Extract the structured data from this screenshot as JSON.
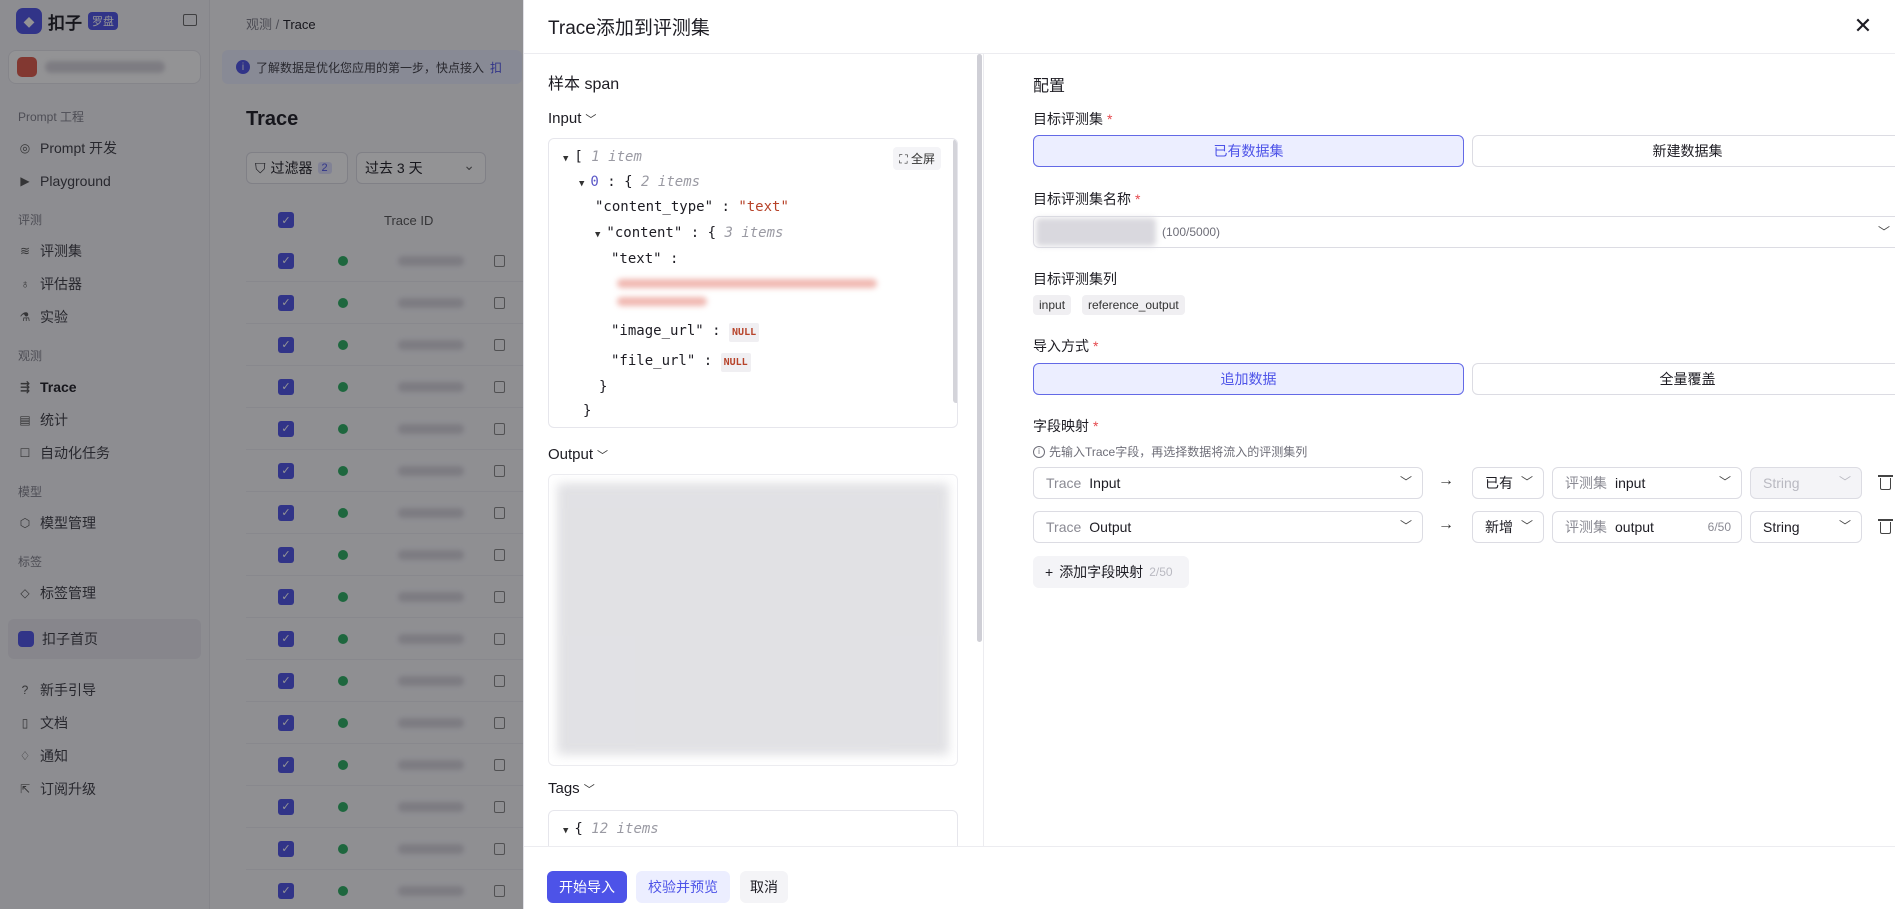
{
  "app": {
    "brand_name": "扣子",
    "brand_tag": "罗盘",
    "sidebar": {
      "groups": [
        {
          "label": "Prompt 工程",
          "items": [
            {
              "label": "Prompt 开发",
              "icon": "target-icon"
            },
            {
              "label": "Playground",
              "icon": "play-icon"
            }
          ]
        },
        {
          "label": "评测",
          "items": [
            {
              "label": "评测集",
              "icon": "database-icon"
            },
            {
              "label": "评估器",
              "icon": "bulb-icon"
            },
            {
              "label": "实验",
              "icon": "flask-icon"
            }
          ]
        },
        {
          "label": "观测",
          "items": [
            {
              "label": "Trace",
              "icon": "trace-icon"
            },
            {
              "label": "统计",
              "icon": "chart-icon"
            },
            {
              "label": "自动化任务",
              "icon": "task-icon"
            }
          ]
        },
        {
          "label": "模型",
          "items": [
            {
              "label": "模型管理",
              "icon": "cube-icon"
            }
          ]
        },
        {
          "label": "标签",
          "items": [
            {
              "label": "标签管理",
              "icon": "tag-icon"
            }
          ]
        }
      ],
      "home": "扣子首页",
      "bottom": [
        {
          "label": "新手引导",
          "icon": "help-icon"
        },
        {
          "label": "文档",
          "icon": "doc-icon"
        },
        {
          "label": "通知",
          "icon": "bell-icon"
        },
        {
          "label": "订阅升级",
          "icon": "upgrade-icon"
        }
      ]
    },
    "breadcrumb": {
      "parent": "观测",
      "current": "Trace"
    },
    "notice": "了解数据是优化您应用的第一步，快点接入",
    "notice_link": "扣",
    "page_title": "Trace",
    "filter_label": "过滤器",
    "filter_count": "2",
    "time_range": "过去 3 天",
    "table_header_trace": "Trace ID",
    "checkmark": "✓"
  },
  "modal": {
    "title": "Trace添加到评测集",
    "close": "✕",
    "sample": {
      "title": "样本 span",
      "input_label": "Input",
      "output_label": "Output",
      "tags_label": "Tags",
      "fullscreen": "全屏",
      "json": {
        "open_bracket": "[",
        "item_count": "1 item",
        "index": "0",
        "colon": ":",
        "open_brace": "{",
        "index_count": "2 items",
        "content_type_key": "\"content_type\"",
        "content_type_val": "\"text\"",
        "content_key": "\"content\"",
        "content_count": "3 items",
        "text_key": "\"text\"",
        "image_url_key": "\"image_url\"",
        "file_url_key": "\"file_url\"",
        "null": "NULL",
        "close_brace": "}",
        "tags_count": "12 items"
      }
    },
    "config": {
      "title": "配置",
      "target_set_label": "目标评测集",
      "target_options": [
        "已有数据集",
        "新建数据集"
      ],
      "target_selected": 0,
      "name_label": "目标评测集名称",
      "name_count": "(100/5000)",
      "columns_label": "目标评测集列",
      "columns": [
        "input",
        "reference_output"
      ],
      "import_label": "导入方式",
      "import_options": [
        "追加数据",
        "全量覆盖"
      ],
      "import_selected": 0,
      "mapping_label": "字段映射",
      "mapping_hint": "先输入Trace字段，再选择数据将流入的评测集列",
      "mappings": [
        {
          "trace_prefix": "Trace",
          "trace_field": "Input",
          "mode": "已有",
          "set_prefix": "评测集",
          "set_field": "input",
          "type": "String",
          "type_disabled": true,
          "counter": ""
        },
        {
          "trace_prefix": "Trace",
          "trace_field": "Output",
          "mode": "新增",
          "set_prefix": "评测集",
          "set_field": "output",
          "type": "String",
          "type_disabled": false,
          "counter": "6/50"
        }
      ],
      "add_mapping": "添加字段映射",
      "add_mapping_count": "2/50"
    },
    "footer": {
      "start": "开始导入",
      "validate": "校验并预览",
      "cancel": "取消"
    }
  },
  "colors": {
    "accent": "#4d53e8",
    "accent_light": "#eceeff",
    "required": "#e5484d",
    "json_string": "#b7432a"
  }
}
